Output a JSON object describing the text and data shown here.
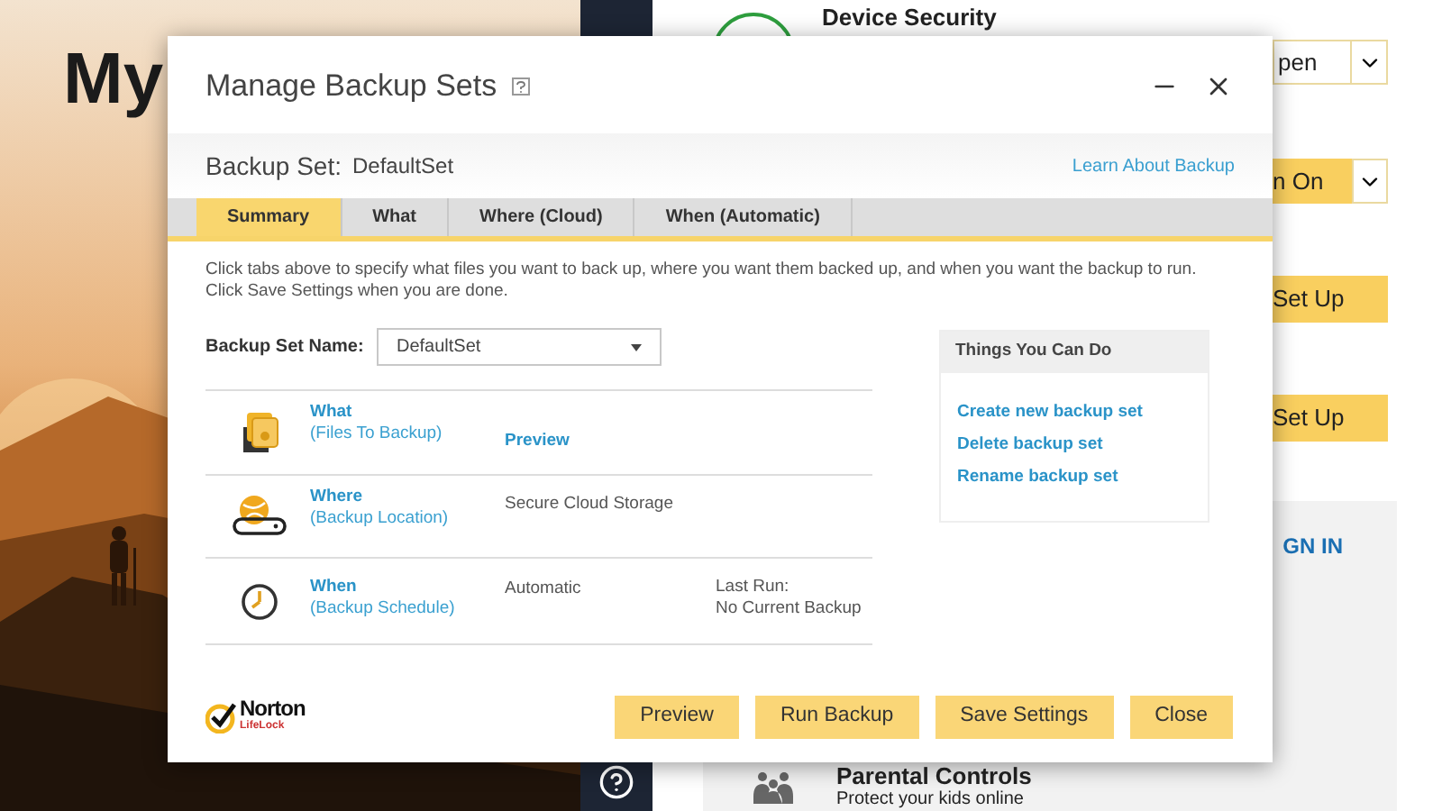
{
  "background": {
    "heading": "My",
    "device_security": "Device Security",
    "side_buttons": [
      {
        "kind": "dropdown",
        "label": "pen"
      },
      {
        "kind": "split",
        "label": "n On"
      },
      {
        "kind": "plain",
        "label": "Set Up"
      },
      {
        "kind": "plain",
        "label": "Set Up"
      }
    ],
    "sign_in": "GN IN",
    "feature": {
      "title": "Parental Controls",
      "subtitle": "Protect your kids online"
    }
  },
  "dialog": {
    "title": "Manage Backup Sets",
    "backup_set_label": "Backup Set:",
    "backup_set_value": "DefaultSet",
    "learn_link": "Learn About Backup",
    "tabs": [
      {
        "label": "Summary",
        "selected": true
      },
      {
        "label": "What",
        "selected": false
      },
      {
        "label": "Where (Cloud)",
        "selected": false
      },
      {
        "label": "When (Automatic)",
        "selected": false
      }
    ],
    "intro": [
      "Click tabs above to specify what files you want to back up, where you want them backed up, and when you want the backup to run.",
      "Click Save Settings when you are done."
    ],
    "name_label": "Backup Set Name:",
    "name_value": "DefaultSet",
    "rows": [
      {
        "kind": "files",
        "title": "What",
        "subtitle": "(Files To Backup)",
        "action": "Preview"
      },
      {
        "kind": "location",
        "title": "Where",
        "subtitle": "(Backup Location)",
        "value": "Secure Cloud Storage"
      },
      {
        "kind": "schedule",
        "title": "When",
        "subtitle": "(Backup Schedule)",
        "value": "Automatic",
        "last_run_label": "Last Run:",
        "last_run_value": "No Current Backup"
      }
    ],
    "things": {
      "title": "Things You Can Do",
      "links": [
        "Create new backup set",
        "Delete backup set",
        "Rename backup set"
      ]
    },
    "logo": {
      "name": "Norton",
      "sub": "LifeLock"
    },
    "buttons": [
      "Preview",
      "Run Backup",
      "Save Settings",
      "Close"
    ]
  }
}
